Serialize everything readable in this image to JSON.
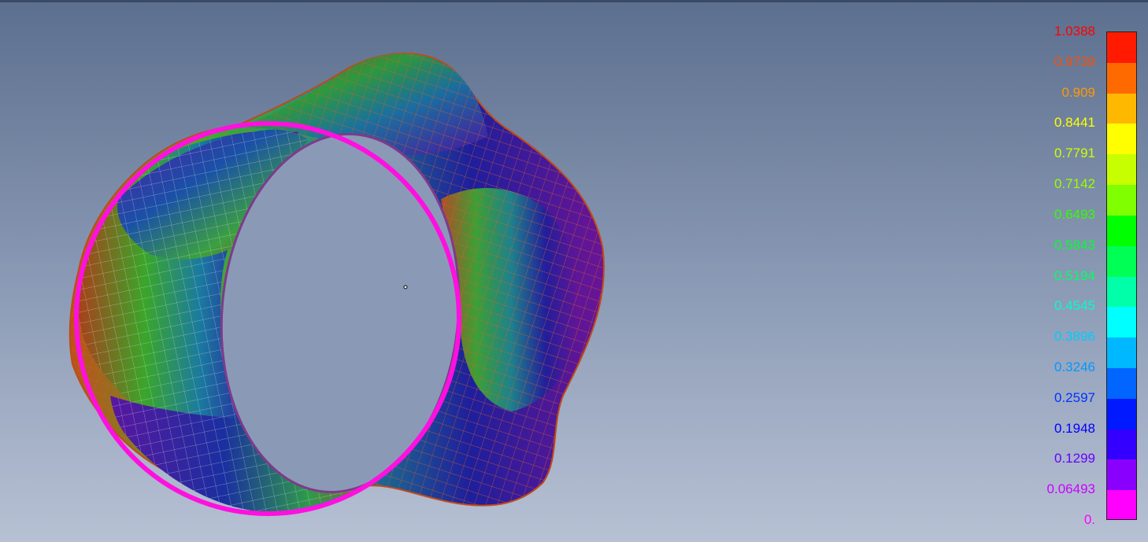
{
  "legend": {
    "labels": [
      {
        "text": "1.0388",
        "color": "#ff0000"
      },
      {
        "text": "0.9739",
        "color": "#ff4d00"
      },
      {
        "text": "0.909",
        "color": "#ff9900"
      },
      {
        "text": "0.8441",
        "color": "#ffff00"
      },
      {
        "text": "0.7791",
        "color": "#ccff00"
      },
      {
        "text": "0.7142",
        "color": "#99ff00"
      },
      {
        "text": "0.6493",
        "color": "#33ff00"
      },
      {
        "text": "0.5843",
        "color": "#00ff33"
      },
      {
        "text": "0.5194",
        "color": "#00ff66"
      },
      {
        "text": "0.4545",
        "color": "#00ffcc"
      },
      {
        "text": "0.3896",
        "color": "#00ccff"
      },
      {
        "text": "0.3246",
        "color": "#0099ff"
      },
      {
        "text": "0.2597",
        "color": "#0033ff"
      },
      {
        "text": "0.1948",
        "color": "#0000ff"
      },
      {
        "text": "0.1299",
        "color": "#6600ff"
      },
      {
        "text": "0.06493",
        "color": "#cc00ff"
      },
      {
        "text": "0.",
        "color": "#ff00ff"
      }
    ],
    "bands": [
      "#ff1a00",
      "#ff6a00",
      "#ffb800",
      "#ffff00",
      "#c8ff00",
      "#80ff00",
      "#00ff00",
      "#00ff55",
      "#00ffa8",
      "#00ffff",
      "#00b8ff",
      "#0066ff",
      "#0019ff",
      "#3300ff",
      "#8a00ff",
      "#ff00ff"
    ]
  },
  "model": {
    "description": "fringe-plot-tube"
  }
}
